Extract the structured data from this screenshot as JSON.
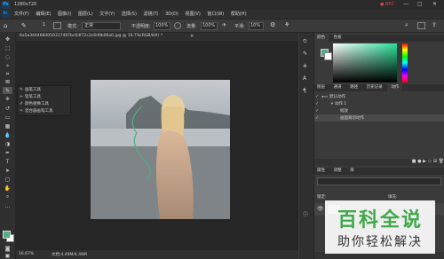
{
  "window": {
    "title": "1280x720",
    "ps_logo": "Ps",
    "rec": "REC",
    "window_controls": [
      "—",
      "□",
      "✕"
    ]
  },
  "menu": [
    "文件(F)",
    "编辑(E)",
    "图像(I)",
    "图层(L)",
    "文字(Y)",
    "选择(S)",
    "滤镜(T)",
    "3D(D)",
    "视图(V)",
    "窗口(W)",
    "帮助(H)"
  ],
  "options": {
    "mode_label": "模式:",
    "mode_value": "正常",
    "opacity_label": "不透明度:",
    "opacity_value": "100%",
    "flow_label": "流量:",
    "flow_value": "100%",
    "smooth_label": "平滑:",
    "smooth_value": "10%",
    "brush_size": "1"
  },
  "document": {
    "tab_title": "6a5a3444684050317497bc6df72c2c6d9b06a0.jpg @ 16.7%(RGB/8#) *",
    "status_zoom": "16.67%",
    "status_doc": "文档:4.49M/4.49M"
  },
  "flyout": {
    "items": [
      "画笔工具",
      "铅笔工具",
      "颜色替换工具",
      "混合器画笔工具"
    ]
  },
  "panels": {
    "color_tabs": [
      "颜色",
      "色板"
    ],
    "layer_tabs": [
      "图层",
      "通道",
      "路径",
      "历史记录",
      "动作"
    ],
    "layers": [
      {
        "name": "默认动作",
        "selected": false
      },
      {
        "name": "动作 1",
        "selected": false
      },
      {
        "name": "缩放",
        "selected": false
      },
      {
        "name": "画面裁切动作",
        "selected": true
      }
    ],
    "props_tabs": [
      "属性",
      "调整",
      "库"
    ],
    "lock_label": "锁定:",
    "fill_label": "填充:"
  },
  "watermark": {
    "title": "百科全说",
    "subtitle": "助你轻松解决"
  },
  "colors": {
    "accent": "#2d8ef0",
    "fg": "#4fae86",
    "watermark_green": "#3fa94a"
  }
}
